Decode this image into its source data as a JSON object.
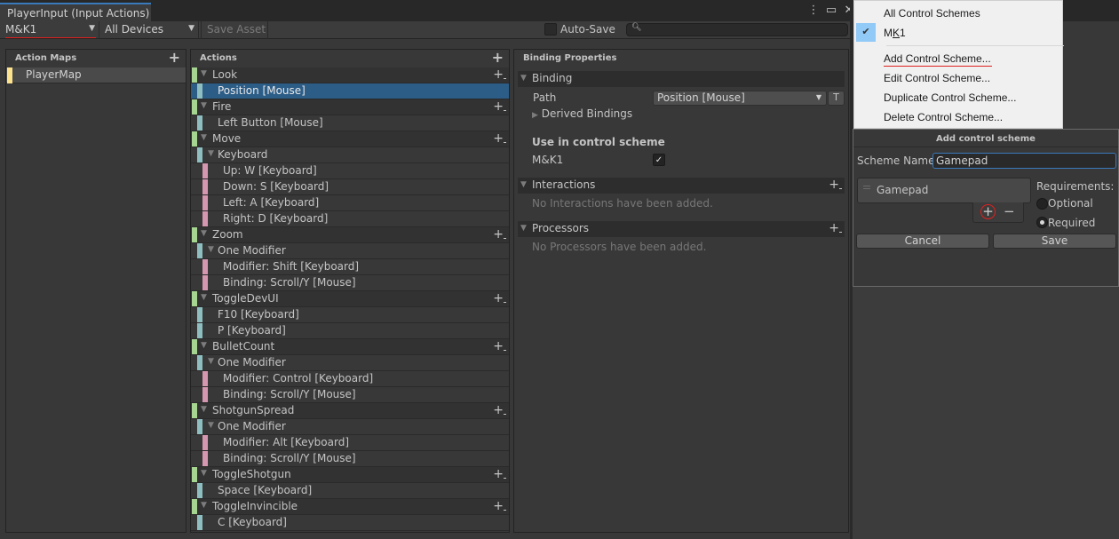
{
  "window": {
    "tab_title": "PlayerInput (Input Actions)",
    "menu_icon": "kebab-menu-icon",
    "maximize_icon": "maximize-icon",
    "close_icon": "close-icon"
  },
  "toolbar": {
    "control_scheme": "M&K1",
    "devices": "All Devices",
    "save_asset": "Save Asset",
    "auto_save_label": "Auto-Save",
    "auto_save_checked": false,
    "search_value": "",
    "search_icon": "search-icon"
  },
  "action_maps": {
    "header": "Action Maps",
    "items": [
      {
        "label": "PlayerMap",
        "selected": true
      }
    ]
  },
  "actions": {
    "header": "Actions",
    "rows": [
      {
        "type": "action",
        "label": "Look"
      },
      {
        "type": "binding",
        "label": "Position [Mouse]",
        "selected": true
      },
      {
        "type": "action",
        "label": "Fire"
      },
      {
        "type": "binding",
        "label": "Left Button [Mouse]"
      },
      {
        "type": "action",
        "label": "Move"
      },
      {
        "type": "composite",
        "label": "Keyboard"
      },
      {
        "type": "part",
        "label": "Up: W [Keyboard]"
      },
      {
        "type": "part",
        "label": "Down: S [Keyboard]"
      },
      {
        "type": "part",
        "label": "Left: A [Keyboard]"
      },
      {
        "type": "part",
        "label": "Right: D [Keyboard]"
      },
      {
        "type": "action",
        "label": "Zoom"
      },
      {
        "type": "composite",
        "label": "One Modifier"
      },
      {
        "type": "part",
        "label": "Modifier: Shift [Keyboard]"
      },
      {
        "type": "part",
        "label": "Binding: Scroll/Y [Mouse]"
      },
      {
        "type": "action",
        "label": "ToggleDevUI"
      },
      {
        "type": "binding",
        "label": "F10 [Keyboard]"
      },
      {
        "type": "binding",
        "label": "P [Keyboard]"
      },
      {
        "type": "action",
        "label": "BulletCount"
      },
      {
        "type": "composite",
        "label": "One Modifier"
      },
      {
        "type": "part",
        "label": "Modifier: Control [Keyboard]"
      },
      {
        "type": "part",
        "label": "Binding: Scroll/Y [Mouse]"
      },
      {
        "type": "action",
        "label": "ShotgunSpread"
      },
      {
        "type": "composite",
        "label": "One Modifier"
      },
      {
        "type": "part",
        "label": "Modifier: Alt [Keyboard]"
      },
      {
        "type": "part",
        "label": "Binding: Scroll/Y [Mouse]"
      },
      {
        "type": "action",
        "label": "ToggleShotgun"
      },
      {
        "type": "binding",
        "label": "Space [Keyboard]"
      },
      {
        "type": "action",
        "label": "ToggleInvincible"
      },
      {
        "type": "binding",
        "label": "C [Keyboard]"
      }
    ]
  },
  "binding_properties": {
    "header": "Binding Properties",
    "binding_section": "Binding",
    "path_label": "Path",
    "path_value": "Position [Mouse]",
    "t_button": "T",
    "derived_bindings": "Derived Bindings",
    "use_in_scheme_label": "Use in control scheme",
    "scheme_name": "M&K1",
    "scheme_checked": true,
    "interactions_section": "Interactions",
    "interactions_empty": "No Interactions have been added.",
    "processors_section": "Processors",
    "processors_empty": "No Processors have been added."
  },
  "scheme_menu": {
    "items": [
      {
        "label": "All Control Schemes"
      },
      {
        "label_pre": "M",
        "label_u": "K",
        "label_post": "1",
        "checked": true
      },
      {
        "label": "Add Control Scheme..."
      },
      {
        "label": "Edit Control Scheme..."
      },
      {
        "label": "Duplicate Control Scheme..."
      },
      {
        "label": "Delete Control Scheme..."
      }
    ]
  },
  "add_scheme_dialog": {
    "title": "Add control scheme",
    "scheme_name_label": "Scheme Name",
    "scheme_name_value": "Gamepad",
    "devices": [
      "Gamepad"
    ],
    "add_label": "+",
    "remove_label": "−",
    "requirements_label": "Requirements:",
    "optional_label": "Optional",
    "required_label": "Required",
    "requirement_selected": "Required",
    "cancel_label": "Cancel",
    "save_label": "Save"
  },
  "colors": {
    "action": "#a6d591",
    "binding": "#8fbec1",
    "part": "#d597b0",
    "map": "#fde38e",
    "selection": "#2c5d87",
    "annotation": "#e02020"
  }
}
